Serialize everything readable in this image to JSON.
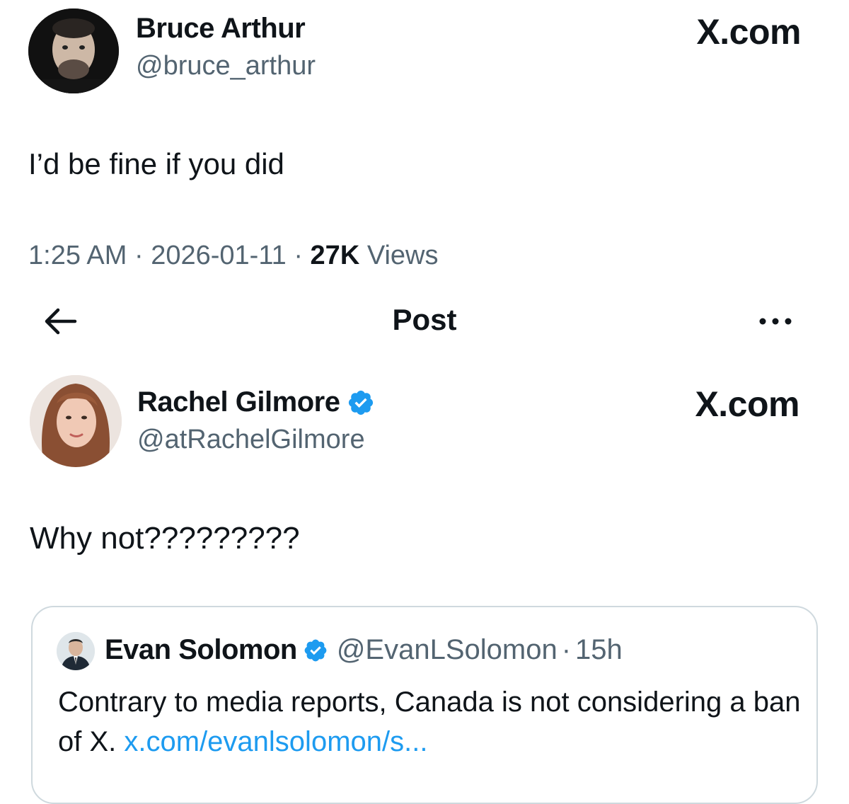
{
  "colors": {
    "text_primary": "#0f1419",
    "text_secondary": "#536471",
    "link": "#1d9bf0",
    "verified": "#1d9bf0",
    "border": "#cfd9de"
  },
  "tweet1": {
    "author_name": "Bruce Arthur",
    "handle": "@bruce_arthur",
    "brand": "X.com",
    "text": "I’d be fine if you did",
    "time": "1:25 AM",
    "sep1": " · ",
    "date": "2026-01-11",
    "sep2": " · ",
    "views_count": "27K",
    "views_label": " Views"
  },
  "nav": {
    "back_icon": "arrow-left-icon",
    "title": "Post",
    "more_icon": "more-horizontal-icon"
  },
  "tweet2": {
    "author_name": "Rachel Gilmore",
    "verified_icon": "verified-badge-icon",
    "handle": "@atRachelGilmore",
    "brand": "X.com",
    "text": "Why not?????????"
  },
  "quote": {
    "author_name": "Evan Solomon",
    "verified_icon": "verified-badge-icon",
    "handle": "@EvanLSolomon",
    "sep": "·",
    "time": "15h",
    "text": "Contrary to media reports, Canada is not considering a ban of X. ",
    "link": "x.com/evanlsolomon/s..."
  }
}
